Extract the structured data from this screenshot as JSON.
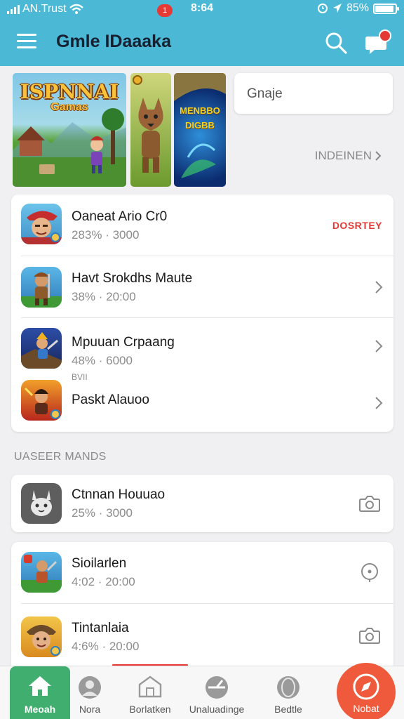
{
  "status_bar": {
    "carrier": "AN.Trust",
    "time": "8:64",
    "battery": "85%"
  },
  "header": {
    "title": "Gmle IDaaaka",
    "chat_badge": ""
  },
  "banner": {
    "thumb1_title": "ISPNNAI",
    "thumb1_subtitle": "Gamas",
    "thumb3_title": "MENBBO DIGBB",
    "search_placeholder": "Gnaje",
    "see_more": "INDEINEN"
  },
  "featured_list": [
    {
      "title": "Oaneat Ario Cr0",
      "meta": "283% · 3000",
      "tag": "DOSRTEY"
    },
    {
      "title": "Havt Srokdhs Maute",
      "meta": "38% · 20:00"
    },
    {
      "title": "Mpuuan Crpaang",
      "meta": "48% · 6000",
      "note": "BVII"
    },
    {
      "title": "Paskt Alauoo"
    }
  ],
  "section_label": "UASEER MANDS",
  "list_single": [
    {
      "title": "Ctnnan Houuao",
      "meta": "25% · 3000"
    }
  ],
  "list_second": [
    {
      "title": "Sioilarlen",
      "meta": "4:02 · 20:00"
    },
    {
      "title": "Tintanlaia",
      "meta": "4:6% · 20:00"
    }
  ],
  "bottom_nav": {
    "items": [
      "Meoah",
      "Nora",
      "Borlatken",
      "Unaluadinge",
      "Bedtle",
      "Nobat"
    ],
    "badge": "1"
  },
  "colors": {
    "header": "#4bb8d6",
    "home_tab": "#3fae6e",
    "fab": "#ef5a3c",
    "accent_red": "#e53935"
  }
}
